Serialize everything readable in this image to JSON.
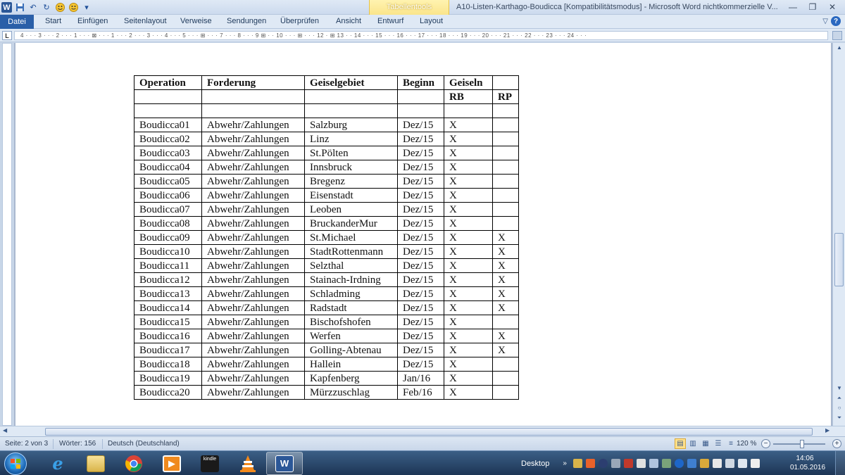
{
  "titlebar": {
    "window_title": "A10-Listen-Karthago-Boudicca [Kompatibilitätsmodus]  -  Microsoft Word nichtkommerzielle V...",
    "context_group": "Tabellentools",
    "word_logo": "W"
  },
  "ribbon": {
    "file_tab": "Datei",
    "tabs": [
      "Start",
      "Einfügen",
      "Seitenlayout",
      "Verweise",
      "Sendungen",
      "Überprüfen",
      "Ansicht",
      "Entwurf",
      "Layout"
    ]
  },
  "ruler": {
    "corner": "L",
    "marks": "4 · · · 3 · · · 2 · · · 1 · · · ⊠ · · · 1 · · · 2 · · · 3 · · · 4 · · · 5 · · · ⊞ · · · 7 · · · 8 · · · 9 ⊞ · · 10 · · · ⊞ · · · 12 · ⊞ 13 · · 14 · · · 15 · · · 16 · · · 17 · · · 18 · · · 19 · · · 20 · · · 21 · · · 22 · · · 23 · · · 24 · · ·"
  },
  "table": {
    "header1": [
      "Operation",
      "Forderung",
      "Geiselgebiet",
      "Beginn",
      "Geiseln",
      ""
    ],
    "header2": [
      "",
      "",
      "",
      "",
      "RB",
      "RP"
    ],
    "blank_row": [
      "",
      "",
      "",
      "",
      "",
      ""
    ],
    "rows": [
      [
        "Boudicca01",
        "Abwehr/Zahlungen",
        "Salzburg",
        "Dez/15",
        "X",
        ""
      ],
      [
        "Boudicca02",
        "Abwehr/Zahlungen",
        "Linz",
        "Dez/15",
        "X",
        ""
      ],
      [
        "Boudicca03",
        "Abwehr/Zahlungen",
        "St.Pölten",
        "Dez/15",
        "X",
        ""
      ],
      [
        "Boudicca04",
        "Abwehr/Zahlungen",
        "Innsbruck",
        "Dez/15",
        "X",
        ""
      ],
      [
        "Boudicca05",
        "Abwehr/Zahlungen",
        "Bregenz",
        "Dez/15",
        "X",
        ""
      ],
      [
        "Boudicca06",
        "Abwehr/Zahlungen",
        "Eisenstadt",
        "Dez/15",
        "X",
        ""
      ],
      [
        "Boudicca07",
        "Abwehr/Zahlungen",
        "Leoben",
        "Dez/15",
        "X",
        ""
      ],
      [
        "Boudicca08",
        "Abwehr/Zahlungen",
        "BruckanderMur",
        "Dez/15",
        "X",
        ""
      ],
      [
        "Boudicca09",
        "Abwehr/Zahlungen",
        "St.Michael",
        "Dez/15",
        "X",
        "X"
      ],
      [
        "Boudicca10",
        "Abwehr/Zahlungen",
        "StadtRottenmann",
        "Dez/15",
        "X",
        "X"
      ],
      [
        "Boudicca11",
        "Abwehr/Zahlungen",
        "Selzthal",
        "Dez/15",
        "X",
        "X"
      ],
      [
        "Boudicca12",
        "Abwehr/Zahlungen",
        "Stainach-Irdning",
        "Dez/15",
        "X",
        "X"
      ],
      [
        "Boudicca13",
        "Abwehr/Zahlungen",
        "Schladming",
        "Dez/15",
        "X",
        "X"
      ],
      [
        "Boudicca14",
        "Abwehr/Zahlungen",
        "Radstadt",
        "Dez/15",
        "X",
        "X"
      ],
      [
        "Boudicca15",
        "Abwehr/Zahlungen",
        "Bischofshofen",
        "Dez/15",
        "X",
        ""
      ],
      [
        "Boudicca16",
        "Abwehr/Zahlungen",
        "Werfen",
        "Dez/15",
        "X",
        "X"
      ],
      [
        "Boudicca17",
        "Abwehr/Zahlungen",
        "Golling-Abtenau",
        "Dez/15",
        "X",
        "X"
      ],
      [
        "Boudicca18",
        "Abwehr/Zahlungen",
        "Hallein",
        "Dez/15",
        "X",
        ""
      ],
      [
        "Boudicca19",
        "Abwehr/Zahlungen",
        "Kapfenberg",
        "Jan/16",
        "X",
        ""
      ],
      [
        "Boudicca20",
        "Abwehr/Zahlungen",
        "Mürzzuschlag",
        "Feb/16",
        "X",
        ""
      ]
    ]
  },
  "statusbar": {
    "page": "Seite: 2 von 3",
    "words": "Wörter: 156",
    "language": "Deutsch (Deutschland)",
    "zoom": "120 %"
  },
  "taskbar": {
    "desktop_label": "Desktop",
    "time": "14:06",
    "date": "01.05.2016",
    "kindle_label": "kindle",
    "word_label": "W"
  }
}
